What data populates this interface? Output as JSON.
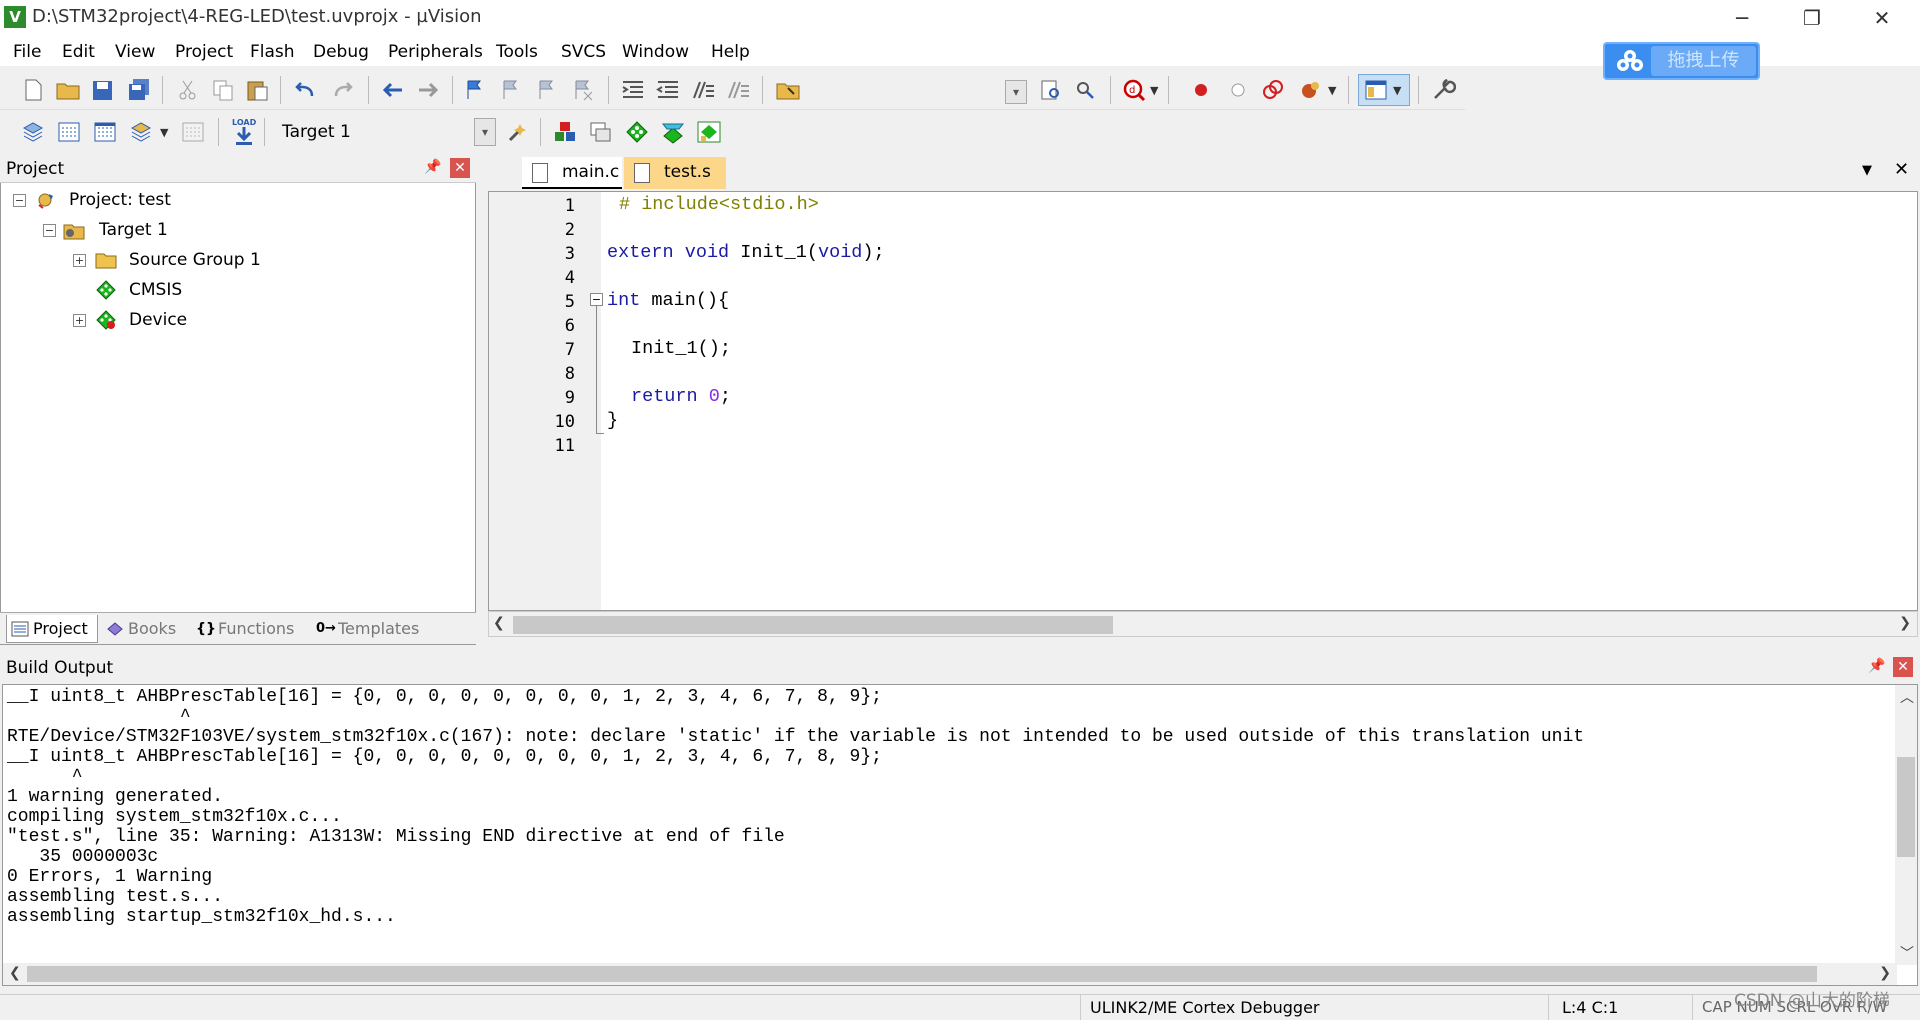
{
  "window": {
    "title": "D:\\STM32project\\4-REG-LED\\test.uvprojx - µVision",
    "app_icon_letter": "V",
    "minimize": "─",
    "restore": "❐",
    "close": "✕"
  },
  "menu": [
    "File",
    "Edit",
    "View",
    "Project",
    "Flash",
    "Debug",
    "Peripherals",
    "Tools",
    "SVCS",
    "Window",
    "Help"
  ],
  "baidu": {
    "button_label": "拖拽上传"
  },
  "toolbar2": {
    "load_label": "LOAD",
    "target_value": "Target 1"
  },
  "project_panel": {
    "title": "Project",
    "tree": [
      {
        "label": "Project: test"
      },
      {
        "label": "Target 1"
      },
      {
        "label": "Source Group 1"
      },
      {
        "label": "CMSIS"
      },
      {
        "label": "Device"
      }
    ],
    "tabs": [
      "Project",
      "Books",
      "Functions",
      "Templates"
    ],
    "tab_glyphs": [
      "{}",
      "0→"
    ]
  },
  "editor": {
    "tabs": [
      "main.c",
      "test.s"
    ],
    "active_tab_color": "#ffffff",
    "inactive_tab_color": "#fdd789",
    "line_numbers": [
      "1",
      "2",
      "3",
      "4",
      "5",
      "6",
      "7",
      "8",
      "9",
      "10",
      "11"
    ],
    "code": {
      "l1_pp": "# include<stdio.h>",
      "l3_kw1": "extern",
      "l3_kw2": "void",
      "l3_mid": " Init_1(",
      "l3_kw3": "void",
      "l3_end": ");",
      "l5_kw": "int",
      "l5_rest": " main(){",
      "l7": "Init_1();",
      "l9_kw": "return",
      "l9_num": "0",
      "l9_end": ";",
      "l10": "}"
    }
  },
  "build_output": {
    "title": "Build Output",
    "lines": [
      "__I uint8_t AHBPrescTable[16] = {0, 0, 0, 0, 0, 0, 0, 0, 1, 2, 3, 4, 6, 7, 8, 9};",
      "                ^",
      "RTE/Device/STM32F103VE/system_stm32f10x.c(167): note: declare 'static' if the variable is not intended to be used outside of this translation unit",
      "__I uint8_t AHBPrescTable[16] = {0, 0, 0, 0, 0, 0, 0, 0, 1, 2, 3, 4, 6, 7, 8, 9};",
      "      ^",
      "1 warning generated.",
      "compiling system_stm32f10x.c...",
      "\"test.s\", line 35: Warning: A1313W: Missing END directive at end of file",
      "   35 0000003c",
      "0 Errors, 1 Warning",
      "assembling test.s...",
      "assembling startup_stm32f10x_hd.s..."
    ]
  },
  "status": {
    "debugger": "ULINK2/ME Cortex Debugger",
    "position": "L:4 C:1",
    "flags": "CAP  NUM  SCRL  OVR  R/W",
    "watermark": "CSDN @山大的阶梯"
  }
}
